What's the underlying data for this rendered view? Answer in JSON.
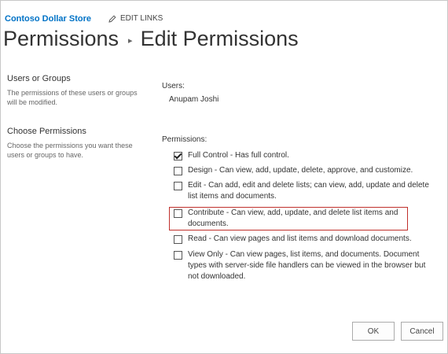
{
  "header": {
    "site_title": "Contoso Dollar Store",
    "edit_links": "EDIT LINKS",
    "edit_icon": "pencil-icon"
  },
  "breadcrumb": {
    "parent": "Permissions",
    "separator_icon": "triangle-right-icon",
    "current": "Edit Permissions"
  },
  "users_section": {
    "title": "Users or Groups",
    "description": "The permissions of these users or groups will be modified.",
    "label": "Users:",
    "user": "Anupam Joshi"
  },
  "permissions_section": {
    "title": "Choose Permissions",
    "description": "Choose the permissions you want these users or groups to have.",
    "label": "Permissions:",
    "items": [
      {
        "label": "Full Control - Has full control.",
        "checked": true
      },
      {
        "label": "Design - Can view, add, update, delete, approve, and customize.",
        "checked": false
      },
      {
        "label": "Edit - Can add, edit and delete lists; can view, add, update and delete list items and documents.",
        "checked": false
      },
      {
        "label": "Contribute - Can view, add, update, and delete list items and documents.",
        "checked": false
      },
      {
        "label": "Read - Can view pages and list items and download documents.",
        "checked": false
      },
      {
        "label": "View Only - Can view pages, list items, and documents. Document types with server-side file handlers can be viewed in the browser but not downloaded.",
        "checked": false
      }
    ],
    "highlight_color": "#c0302c"
  },
  "buttons": {
    "ok": "OK",
    "cancel": "Cancel"
  },
  "colors": {
    "link": "#0072c6",
    "text": "#333333"
  }
}
